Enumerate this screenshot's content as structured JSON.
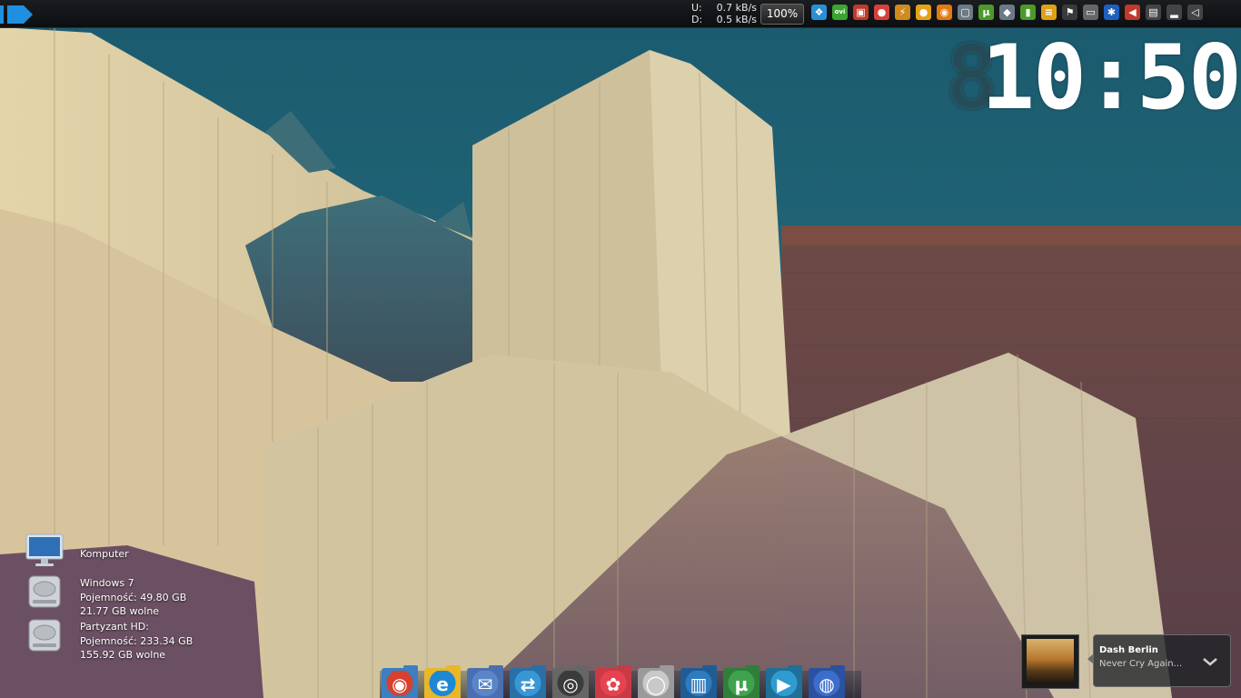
{
  "topbar": {
    "net": {
      "upload_label": "U:",
      "upload_value": "0.7 kB/s",
      "download_label": "D:",
      "download_value": "0.5 kB/s"
    },
    "zoom": "100%",
    "tray_icons": [
      {
        "name": "dropbox-icon",
        "glyph": "❖",
        "color": "#2b8fd6"
      },
      {
        "name": "ovi-icon",
        "glyph": "ovi",
        "color": "#3aa52f"
      },
      {
        "name": "app-icon",
        "glyph": "▣",
        "color": "#c0392b"
      },
      {
        "name": "record-icon",
        "glyph": "●",
        "color": "#d6403a"
      },
      {
        "name": "flash-icon",
        "glyph": "⚡",
        "color": "#d08a1e"
      },
      {
        "name": "coin-icon",
        "glyph": "●",
        "color": "#e3a21a"
      },
      {
        "name": "avast-icon",
        "glyph": "◉",
        "color": "#e07a12"
      },
      {
        "name": "window-icon",
        "glyph": "▢",
        "color": "#6c7a86"
      },
      {
        "name": "utorrent-tray-icon",
        "glyph": "µ",
        "color": "#4c9b2a"
      },
      {
        "name": "drop-icon",
        "glyph": "◆",
        "color": "#6c7a86"
      },
      {
        "name": "battery-meter-icon",
        "glyph": "▮",
        "color": "#4c9b2a"
      },
      {
        "name": "message-icon",
        "glyph": "≡",
        "color": "#e0a018"
      },
      {
        "name": "flag-icon",
        "glyph": "⚑",
        "color": "#3a3a3a"
      },
      {
        "name": "monitor-icon",
        "glyph": "▭",
        "color": "#666666"
      },
      {
        "name": "bluetooth-icon",
        "glyph": "✱",
        "color": "#1f5fbf"
      },
      {
        "name": "mute-icon",
        "glyph": "◀",
        "color": "#c0392b"
      },
      {
        "name": "power-icon",
        "glyph": "▤",
        "color": "#444444"
      },
      {
        "name": "signal-icon",
        "glyph": "▂",
        "color": "#444444"
      },
      {
        "name": "volume-icon",
        "glyph": "◁",
        "color": "#444444"
      }
    ]
  },
  "clock": {
    "ghost": "8",
    "time": "10:50"
  },
  "desktop": {
    "computer": {
      "label": "Komputer"
    },
    "drive1": {
      "name": "Windows 7",
      "capacity": "Pojemność: 49.80 GB",
      "free": "21.77 GB wolne"
    },
    "drive2": {
      "name": "Partyzant HD:",
      "capacity": "Pojemność: 233.34 GB",
      "free": "155.92 GB wolne"
    }
  },
  "dock": [
    {
      "name": "chrome-dock-icon",
      "glyph": "◉",
      "color": "#d6402f",
      "tab": "#3d7fbf"
    },
    {
      "name": "ie-dock-icon",
      "glyph": "e",
      "color": "#1e88d4",
      "tab": "#e9b728"
    },
    {
      "name": "mail-dock-icon",
      "glyph": "✉",
      "color": "#5a86c8",
      "tab": "#4a6fb0"
    },
    {
      "name": "teamviewer-dock-icon",
      "glyph": "⇄",
      "color": "#3a97d6",
      "tab": "#2a6fa6"
    },
    {
      "name": "camera-dock-icon",
      "glyph": "◎",
      "color": "#3b3b3b",
      "tab": "#666666"
    },
    {
      "name": "picasa-dock-icon",
      "glyph": "✿",
      "color": "#e7424f",
      "tab": "#c83a45"
    },
    {
      "name": "dvd-dock-icon",
      "glyph": "◯",
      "color": "#c9c9c9",
      "tab": "#9a9a9a"
    },
    {
      "name": "library-dock-icon",
      "glyph": "▥",
      "color": "#2e7bbf",
      "tab": "#1f5c94"
    },
    {
      "name": "utorrent-dock-icon",
      "glyph": "µ",
      "color": "#3fa34d",
      "tab": "#2f7f3a"
    },
    {
      "name": "media-player-dock-icon",
      "glyph": "▶",
      "color": "#2f9bd1",
      "tab": "#1f6f99"
    },
    {
      "name": "finder-dock-icon",
      "glyph": "◍",
      "color": "#3d6dcc",
      "tab": "#2b51a0"
    }
  ],
  "now_playing": {
    "artist": "Dash Berlin",
    "title": "Never Cry Again..."
  }
}
